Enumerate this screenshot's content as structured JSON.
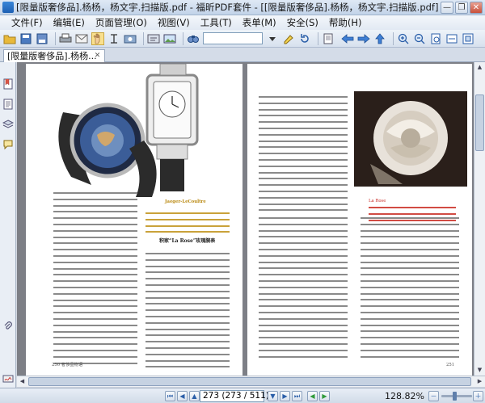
{
  "window": {
    "title": "[限量版奢侈品].杨杨，杨文宇.扫描版.pdf - 福昕PDF套件 - [[限量版奢侈品].杨杨，杨文宇.扫描版.pdf]",
    "minimize": "—",
    "restore": "❐",
    "close": "✕"
  },
  "menu": {
    "items": [
      "文件(F)",
      "编辑(E)",
      "页面管理(O)",
      "视图(V)",
      "工具(T)",
      "表单(M)",
      "安全(S)",
      "帮助(H)"
    ]
  },
  "toolbar": {
    "icons": [
      "open-folder-icon",
      "save-icon",
      "print-icon",
      "hand-tool-icon",
      "select-text-icon",
      "snapshot-icon",
      "find-icon",
      "zoom-in-icon",
      "zoom-out-icon"
    ],
    "find_value": ""
  },
  "tabs": {
    "active_label": "[限量版奢侈品].杨杨..."
  },
  "pages": {
    "left": {
      "caption": "积家“La Rose”玫瑰腕表",
      "footer": "250 奢侈品物语",
      "brand_label": "Jaeger-LeCoultre"
    },
    "right": {
      "caption": "La Rose",
      "footer": "251"
    }
  },
  "status": {
    "page_value": "273 (273 / 511)",
    "zoom": "128.82%"
  },
  "colors": {
    "titlebar": "#c8d7eb",
    "accent": "#2a5ea8"
  }
}
